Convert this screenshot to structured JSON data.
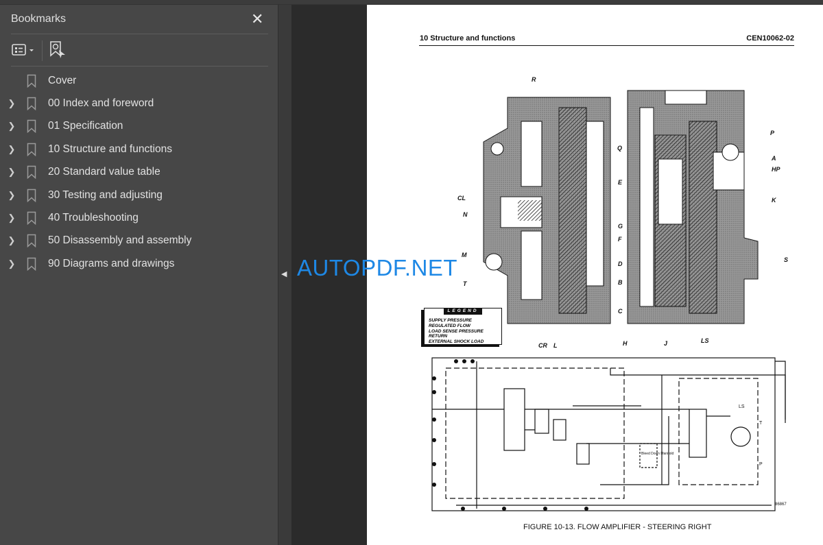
{
  "sidebar": {
    "title": "Bookmarks",
    "close_icon": "close-icon",
    "tools": [
      "options-icon",
      "bookmark-add-icon"
    ],
    "items": [
      {
        "label": "Cover",
        "expandable": false
      },
      {
        "label": "00 Index and foreword",
        "expandable": true
      },
      {
        "label": "01 Specification",
        "expandable": true
      },
      {
        "label": "10 Structure and functions",
        "expandable": true
      },
      {
        "label": "20 Standard value table",
        "expandable": true
      },
      {
        "label": "30 Testing and adjusting",
        "expandable": true
      },
      {
        "label": "40 Troubleshooting",
        "expandable": true
      },
      {
        "label": "50 Disassembly and assembly",
        "expandable": true
      },
      {
        "label": "90 Diagrams and drawings",
        "expandable": true
      }
    ]
  },
  "page": {
    "header_left": "10 Structure and functions",
    "header_right": "CEN10062-02",
    "caption": "FIGURE 10-13. FLOW AMPLIFIER - STEERING RIGHT",
    "figure_number": "86867",
    "labels": [
      "R",
      "Q",
      "P",
      "A",
      "HP",
      "CL",
      "K",
      "N",
      "E",
      "G",
      "F",
      "M",
      "D",
      "T",
      "B",
      "S",
      "C",
      "CR",
      "L",
      "H",
      "J",
      "LS"
    ],
    "legend": {
      "title": "LEGEND",
      "items": [
        "SUPPLY PRESSURE",
        "REGULATED FLOW",
        "LOAD SENSE PRESSURE",
        "RETURN",
        "EXTERNAL SHOCK LOAD"
      ]
    },
    "schematic_labels": {
      "bleed": "Bleed Down Manifold",
      "ls": "LS",
      "t": "T",
      "p": "P"
    }
  },
  "watermark": "AUTOPDF.NET",
  "colors": {
    "sidebar": "#474747",
    "viewer": "#2b2b2b",
    "watermark": "#1e88e5"
  }
}
